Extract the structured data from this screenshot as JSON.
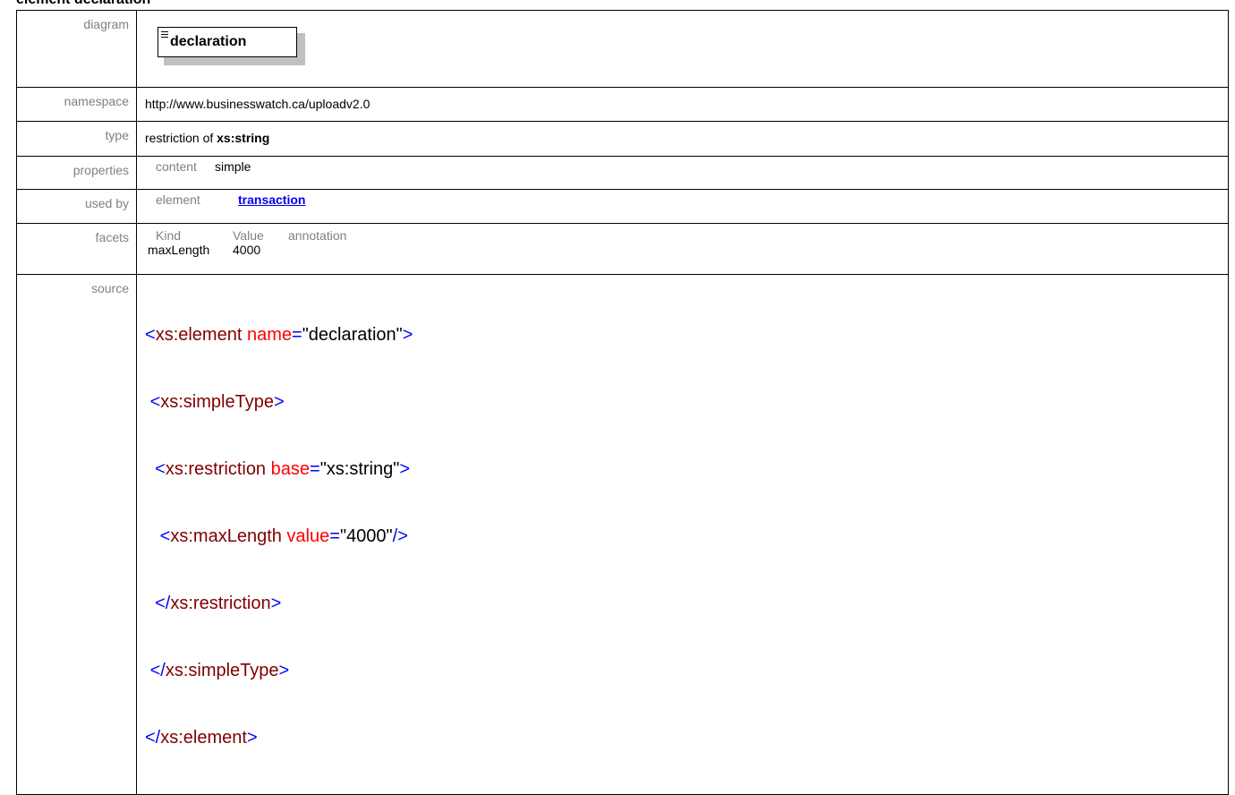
{
  "heading": "element declaration",
  "rows": {
    "diagram": {
      "label": "diagram",
      "element_name": "declaration"
    },
    "namespace": {
      "label": "namespace",
      "value": "http://www.businesswatch.ca/uploadv2.0"
    },
    "type": {
      "label": "type",
      "prefix": "restriction of ",
      "base": "xs:string"
    },
    "properties": {
      "label": "properties",
      "key": "content",
      "value": "simple"
    },
    "used_by": {
      "label": "used by",
      "key": "element",
      "link": "transaction"
    },
    "facets": {
      "label": "facets",
      "headers": [
        "Kind",
        "Value",
        "annotation"
      ],
      "rows": [
        {
          "kind": "maxLength",
          "value": "4000",
          "annotation": ""
        }
      ]
    },
    "source": {
      "label": "source",
      "lines": [
        {
          "indent": "",
          "open": "<",
          "tag": "xs:element",
          "attr": " name",
          "eq": "=",
          "val": "\"declaration\"",
          "close": ">"
        },
        {
          "indent": " ",
          "open": "<",
          "tag": "xs:simpleType",
          "attr": "",
          "eq": "",
          "val": "",
          "close": ">"
        },
        {
          "indent": "  ",
          "open": "<",
          "tag": "xs:restriction",
          "attr": " base",
          "eq": "=",
          "val": "\"xs:string\"",
          "close": ">"
        },
        {
          "indent": "   ",
          "open": "<",
          "tag": "xs:maxLength",
          "attr": " value",
          "eq": "=",
          "val": "\"4000\"",
          "close": "/>"
        },
        {
          "indent": "  ",
          "open": "</",
          "tag": "xs:restriction",
          "attr": "",
          "eq": "",
          "val": "",
          "close": ">"
        },
        {
          "indent": " ",
          "open": "</",
          "tag": "xs:simpleType",
          "attr": "",
          "eq": "",
          "val": "",
          "close": ">"
        },
        {
          "indent": "",
          "open": "</",
          "tag": "xs:element",
          "attr": "",
          "eq": "",
          "val": "",
          "close": ">"
        }
      ]
    }
  }
}
